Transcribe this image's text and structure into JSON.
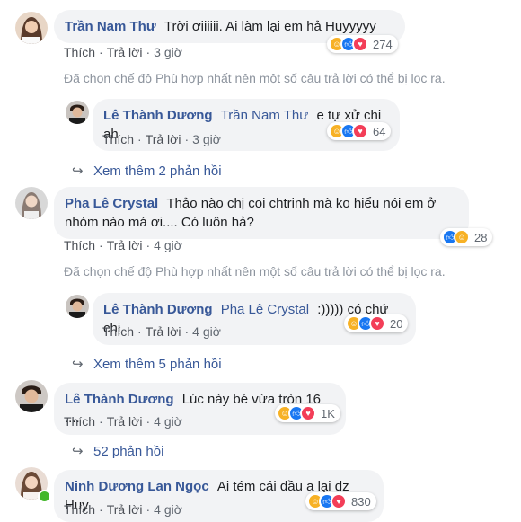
{
  "actions": {
    "like": "Thích",
    "reply": "Trả lời",
    "dot": "·"
  },
  "filter_notice": "Đã chọn chế độ Phù hợp nhất nên một số câu trả lời có thể bị lọc ra.",
  "comments": [
    {
      "author": "Trần Nam Thư",
      "text": "Trời ơiiiiii. Ai làm lại em hả Huyyyyy",
      "time": "3 giờ",
      "reactions": [
        "haha",
        "like",
        "love"
      ],
      "count": "274"
    },
    {
      "author": "Lê Thành Dương",
      "mention": "Trần Nam Thư",
      "text": "e tự xử chi ah",
      "time": "3 giờ",
      "reactions": [
        "haha",
        "like",
        "love"
      ],
      "count": "64"
    },
    {
      "more": "Xem thêm 2 phản hồi"
    },
    {
      "author": "Pha Lê Crystal",
      "text_line1": "Thảo nào chị coi chtrinh mà ko hiểu nói em ở",
      "text_line2": "nhóm nào má ơi.... Có luôn hả?",
      "time": "4 giờ",
      "reactions": [
        "like",
        "haha"
      ],
      "count": "28"
    },
    {
      "author": "Lê Thành Dương",
      "mention": "Pha Lê Crystal",
      "text": ":))))) có chứ chị",
      "time": "4 giờ",
      "reactions": [
        "haha",
        "like",
        "love"
      ],
      "count": "20"
    },
    {
      "more": "Xem thêm 5 phản hồi"
    },
    {
      "author": "Lê Thành Dương",
      "text": "Lúc này bé vừa tròn 16 ....",
      "time": "4 giờ",
      "reactions": [
        "haha",
        "like",
        "love"
      ],
      "count": "1K"
    },
    {
      "more": "52 phản hồi"
    },
    {
      "author": "Ninh Dương Lan Ngọc",
      "text": "Ai tém cái đầu a lại dz Huy",
      "time": "4 giờ",
      "reactions": [
        "haha",
        "like",
        "love"
      ],
      "count": "830"
    }
  ],
  "colors": {
    "link": "#385898",
    "bubble": "#f2f3f5",
    "meta": "#606770",
    "filter": "#8d949e"
  }
}
